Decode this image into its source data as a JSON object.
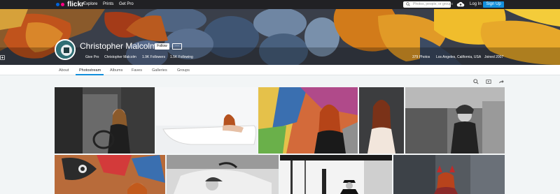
{
  "topnav": {
    "logo_text": "flickr",
    "links": [
      "Explore",
      "Prints",
      "Get Pro"
    ],
    "search_placeholder": "Photos, people, or groups",
    "login_label": "Log In",
    "signup_label": "Sign Up",
    "colors": {
      "bar": "#212124",
      "blue_dot": "#0063dc",
      "pink_dot": "#ff0084",
      "signup": "#128fdc"
    }
  },
  "profile": {
    "name": "Christopher Malcolm",
    "follow_label": "Follow",
    "more_label": "···",
    "give_pro": "Give Pro",
    "username": "Christopher Malcolm",
    "followers": "1.9K Followers",
    "following": "1.5K Following",
    "photos": "379 Photos",
    "location": "Los Angeles, California, USA",
    "joined": "Joined 2007"
  },
  "tabs": [
    {
      "label": "About",
      "active": false
    },
    {
      "label": "Photostream",
      "active": true
    },
    {
      "label": "Albums",
      "active": false
    },
    {
      "label": "Faves",
      "active": false
    },
    {
      "label": "Galleries",
      "active": false
    },
    {
      "label": "Groups",
      "active": false
    }
  ],
  "toolbar": {
    "icons": [
      "search-icon",
      "slideshow-icon",
      "share-icon"
    ]
  },
  "photos_row1": [
    "photo-1",
    "photo-2",
    "photo-3",
    "photo-4",
    "photo-5"
  ],
  "photos_row2": [
    "photo-6",
    "photo-7",
    "photo-8",
    "photo-9"
  ]
}
